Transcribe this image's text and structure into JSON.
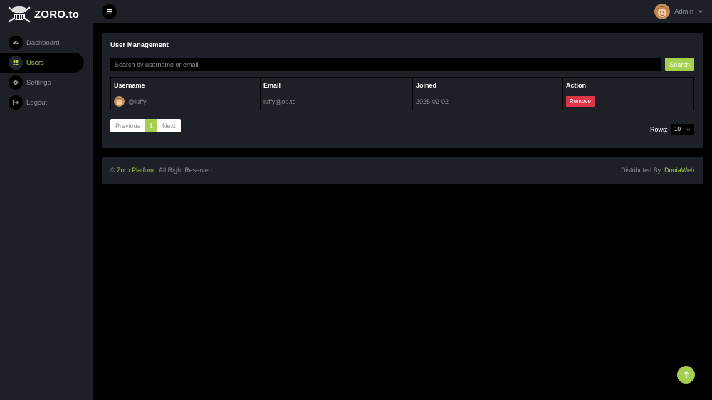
{
  "brand": {
    "name": "ZORO.to"
  },
  "sidebar": {
    "items": [
      {
        "label": "Dashboard",
        "icon": "dashboard-icon",
        "active": false
      },
      {
        "label": "Users",
        "icon": "users-icon",
        "active": true
      },
      {
        "label": "Settings",
        "icon": "gear-icon",
        "active": false
      },
      {
        "label": "Logout",
        "icon": "logout-icon",
        "active": false
      }
    ]
  },
  "header": {
    "user_name": "Admin"
  },
  "main": {
    "title": "User Management",
    "search": {
      "placeholder": "Search by username or email",
      "value": "",
      "button_label": "Search"
    },
    "table": {
      "columns": [
        "Username",
        "Email",
        "Joined",
        "Action"
      ],
      "rows": [
        {
          "username": "@luffy",
          "email": "luffy@op.to",
          "joined": "2025-02-02",
          "action_label": "Remove"
        }
      ]
    },
    "pagination": {
      "previous_label": "Previous",
      "current_page": "1",
      "next_label": "Next"
    },
    "rows_per_page": {
      "label": "Rows:",
      "value": "10"
    }
  },
  "footer": {
    "copyright_symbol": "©",
    "platform_link": "Zoro Platform",
    "rights_text": ". All Right Reserved.",
    "distributed_label": "Distributed By:",
    "distributor_link": "DoniaWeb"
  },
  "colors": {
    "accent": "#a5cf4f",
    "panel": "#1e2027",
    "background": "#000000",
    "danger": "#dc3545"
  }
}
